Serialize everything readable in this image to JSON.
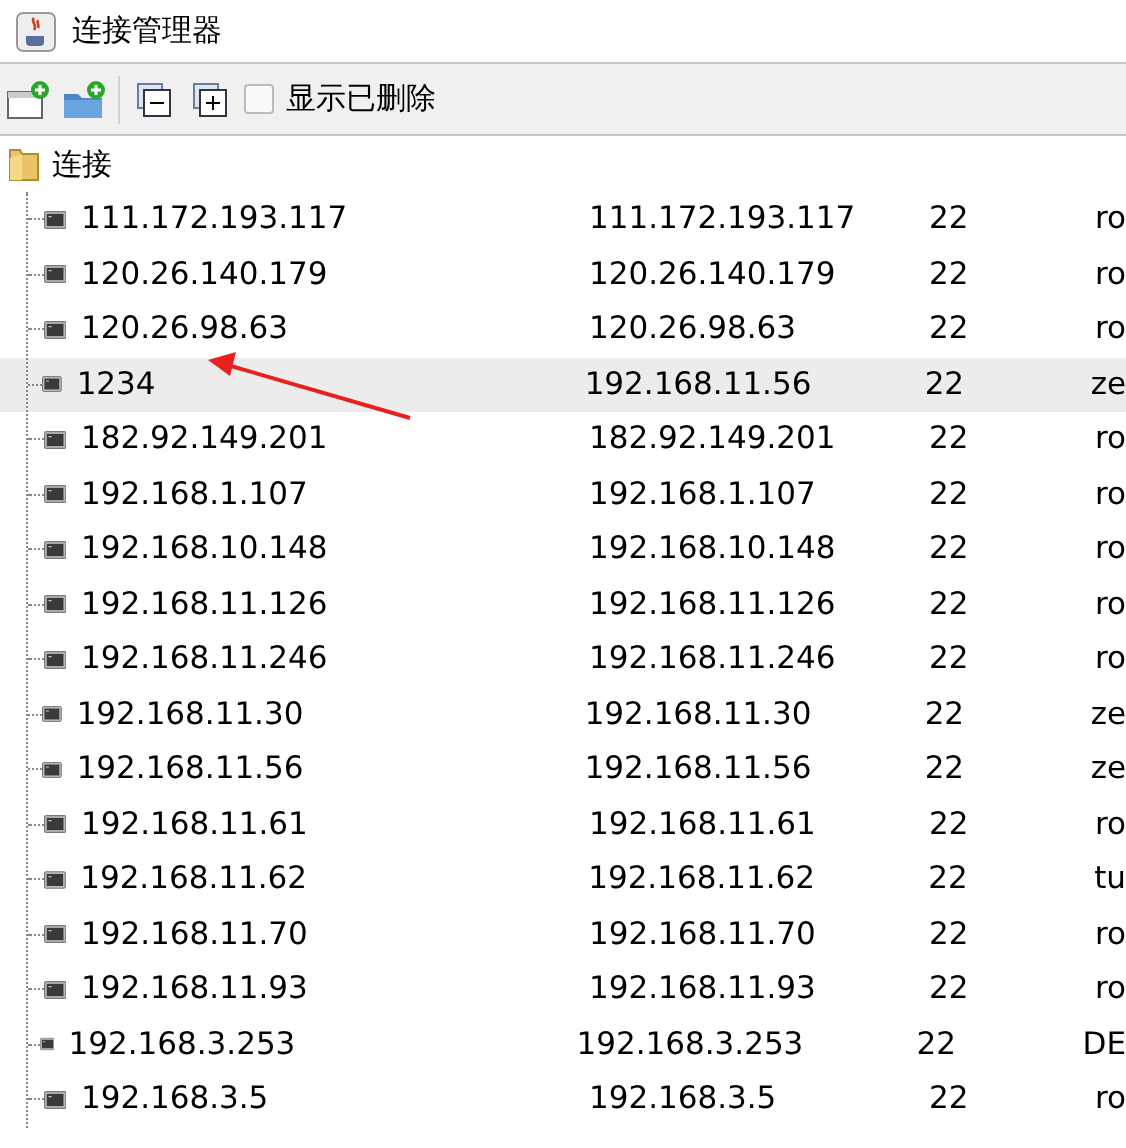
{
  "window": {
    "title": "连接管理器"
  },
  "toolbar": {
    "show_deleted": {
      "label": "显示已删除",
      "checked": false
    }
  },
  "tree": {
    "label": "连接",
    "children": [
      {
        "name": "111.172.193.117",
        "host": "111.172.193.117",
        "port": "22",
        "user": "ro",
        "selected": false
      },
      {
        "name": "120.26.140.179",
        "host": "120.26.140.179",
        "port": "22",
        "user": "ro",
        "selected": false
      },
      {
        "name": "120.26.98.63",
        "host": "120.26.98.63",
        "port": "22",
        "user": "ro",
        "selected": false
      },
      {
        "name": "1234",
        "host": "192.168.11.56",
        "port": "22",
        "user": "ze",
        "selected": true
      },
      {
        "name": "182.92.149.201",
        "host": "182.92.149.201",
        "port": "22",
        "user": "ro",
        "selected": false
      },
      {
        "name": "192.168.1.107",
        "host": "192.168.1.107",
        "port": "22",
        "user": "ro",
        "selected": false
      },
      {
        "name": "192.168.10.148",
        "host": "192.168.10.148",
        "port": "22",
        "user": "ro",
        "selected": false
      },
      {
        "name": "192.168.11.126",
        "host": "192.168.11.126",
        "port": "22",
        "user": "ro",
        "selected": false
      },
      {
        "name": "192.168.11.246",
        "host": "192.168.11.246",
        "port": "22",
        "user": "ro",
        "selected": false
      },
      {
        "name": "192.168.11.30",
        "host": "192.168.11.30",
        "port": "22",
        "user": "ze",
        "selected": false
      },
      {
        "name": "192.168.11.56",
        "host": "192.168.11.56",
        "port": "22",
        "user": "ze",
        "selected": false
      },
      {
        "name": "192.168.11.61",
        "host": "192.168.11.61",
        "port": "22",
        "user": "ro",
        "selected": false
      },
      {
        "name": "192.168.11.62",
        "host": "192.168.11.62",
        "port": "22",
        "user": "tu",
        "selected": false
      },
      {
        "name": "192.168.11.70",
        "host": "192.168.11.70",
        "port": "22",
        "user": "ro",
        "selected": false
      },
      {
        "name": "192.168.11.93",
        "host": "192.168.11.93",
        "port": "22",
        "user": "ro",
        "selected": false
      },
      {
        "name": "192.168.3.253",
        "host": "192.168.3.253",
        "port": "22",
        "user": "DE",
        "selected": false
      },
      {
        "name": "192.168.3.5",
        "host": "192.168.3.5",
        "port": "22",
        "user": "ro",
        "selected": false
      }
    ]
  }
}
